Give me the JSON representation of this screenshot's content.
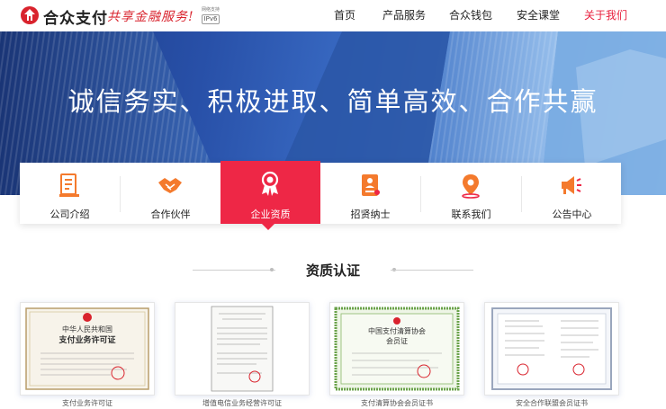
{
  "header": {
    "logo_name": "合众支付",
    "slogan": "共享金融服务!",
    "ipv6_small": "网络支持",
    "ipv6_label": "IPv6",
    "nav": [
      {
        "label": "首页"
      },
      {
        "label": "产品服务"
      },
      {
        "label": "合众钱包"
      },
      {
        "label": "安全课堂"
      },
      {
        "label": "关于我们",
        "active": true
      }
    ]
  },
  "banner": {
    "title": "诚信务实、积极进取、简单高效、合作共赢"
  },
  "features": [
    {
      "label": "公司介绍",
      "icon": "document-icon"
    },
    {
      "label": "合作伙伴",
      "icon": "handshake-icon"
    },
    {
      "label": "企业资质",
      "icon": "award-badge-icon",
      "active": true
    },
    {
      "label": "招贤纳士",
      "icon": "resume-icon"
    },
    {
      "label": "联系我们",
      "icon": "location-pin-icon"
    },
    {
      "label": "公告中心",
      "icon": "megaphone-icon"
    }
  ],
  "section": {
    "title": "资质认证"
  },
  "certificates": [
    {
      "label": "支付业务许可证",
      "title_line1": "中华人民共和国",
      "title_line2": "支付业务许可证"
    },
    {
      "label": "增值电信业务经营许可证"
    },
    {
      "label": "支付清算协会会员证书",
      "title_line1": "中国支付清算协会",
      "title_line2": "会员证"
    },
    {
      "label": "安全合作联盟会员证书"
    }
  ],
  "colors": {
    "brand_red": "#e81e3c",
    "active_tab": "#ee2746",
    "banner_blue": "#2850a8"
  }
}
